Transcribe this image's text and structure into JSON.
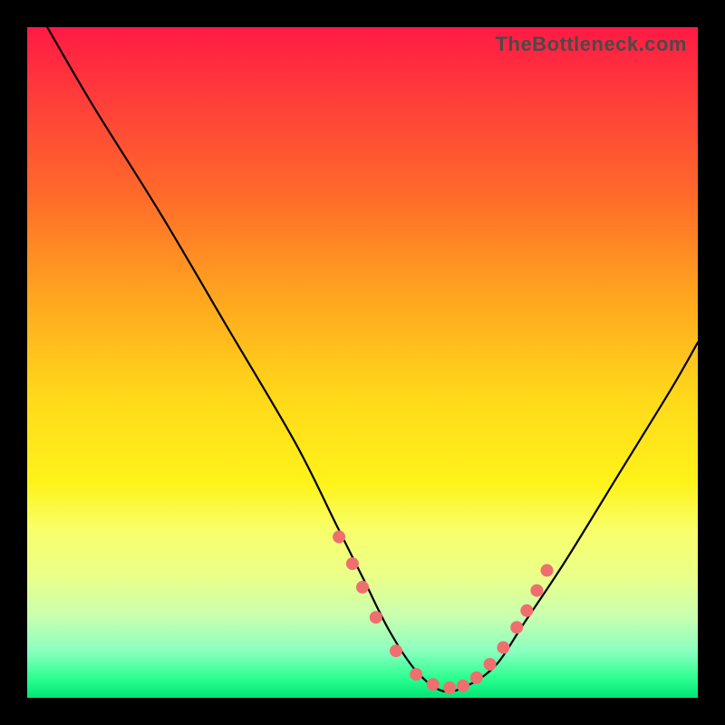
{
  "watermark": "TheBottleneck.com",
  "chart_data": {
    "type": "line",
    "title": "",
    "xlabel": "",
    "ylabel": "",
    "xlim": [
      0,
      100
    ],
    "ylim": [
      0,
      100
    ],
    "grid": false,
    "legend": false,
    "series": [
      {
        "name": "bottleneck-curve",
        "x": [
          3,
          10,
          20,
          30,
          40,
          46,
          50,
          54,
          58,
          62,
          66,
          70,
          74,
          80,
          88,
          96,
          100
        ],
        "y": [
          100,
          88,
          72,
          55,
          38,
          26,
          18,
          10,
          4,
          1,
          2,
          5,
          11,
          20,
          33,
          46,
          53
        ]
      }
    ],
    "markers": {
      "name": "flat-region-dots",
      "x": [
        46.5,
        48.5,
        50.0,
        52.0,
        55.0,
        58.0,
        60.5,
        63.0,
        65.0,
        67.0,
        69.0,
        71.0,
        73.0,
        74.5,
        76.0,
        77.5
      ],
      "y": [
        24.0,
        20.0,
        16.5,
        12.0,
        7.0,
        3.5,
        2.0,
        1.5,
        1.8,
        3.0,
        5.0,
        7.5,
        10.5,
        13.0,
        16.0,
        19.0
      ]
    },
    "gradient_stops": [
      {
        "pos": 0.0,
        "color": "#ff1a44"
      },
      {
        "pos": 0.1,
        "color": "#ff3b3b"
      },
      {
        "pos": 0.25,
        "color": "#ff6a2a"
      },
      {
        "pos": 0.4,
        "color": "#ffa51f"
      },
      {
        "pos": 0.55,
        "color": "#ffd81a"
      },
      {
        "pos": 0.68,
        "color": "#fff31a"
      },
      {
        "pos": 0.75,
        "color": "#f8ff6a"
      },
      {
        "pos": 0.82,
        "color": "#eaff8a"
      },
      {
        "pos": 0.88,
        "color": "#c8ffb0"
      },
      {
        "pos": 0.93,
        "color": "#8affc0"
      },
      {
        "pos": 0.97,
        "color": "#2dff90"
      },
      {
        "pos": 1.0,
        "color": "#00e676"
      }
    ]
  }
}
